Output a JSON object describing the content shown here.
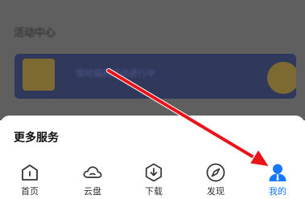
{
  "background": {
    "section_title": "活动中心",
    "banner_text": "限时福利活动进行中"
  },
  "sheet": {
    "title": "更多服务"
  },
  "tabbar": {
    "tabs": [
      {
        "label": "首页",
        "icon": "home-icon"
      },
      {
        "label": "云盘",
        "icon": "cloud-icon"
      },
      {
        "label": "下载",
        "icon": "download-icon"
      },
      {
        "label": "发现",
        "icon": "compass-icon"
      },
      {
        "label": "我的",
        "icon": "user-icon",
        "active": true
      }
    ]
  },
  "colors": {
    "active": "#1677ff",
    "arrow": "#e8141a",
    "icon": "#333333"
  }
}
